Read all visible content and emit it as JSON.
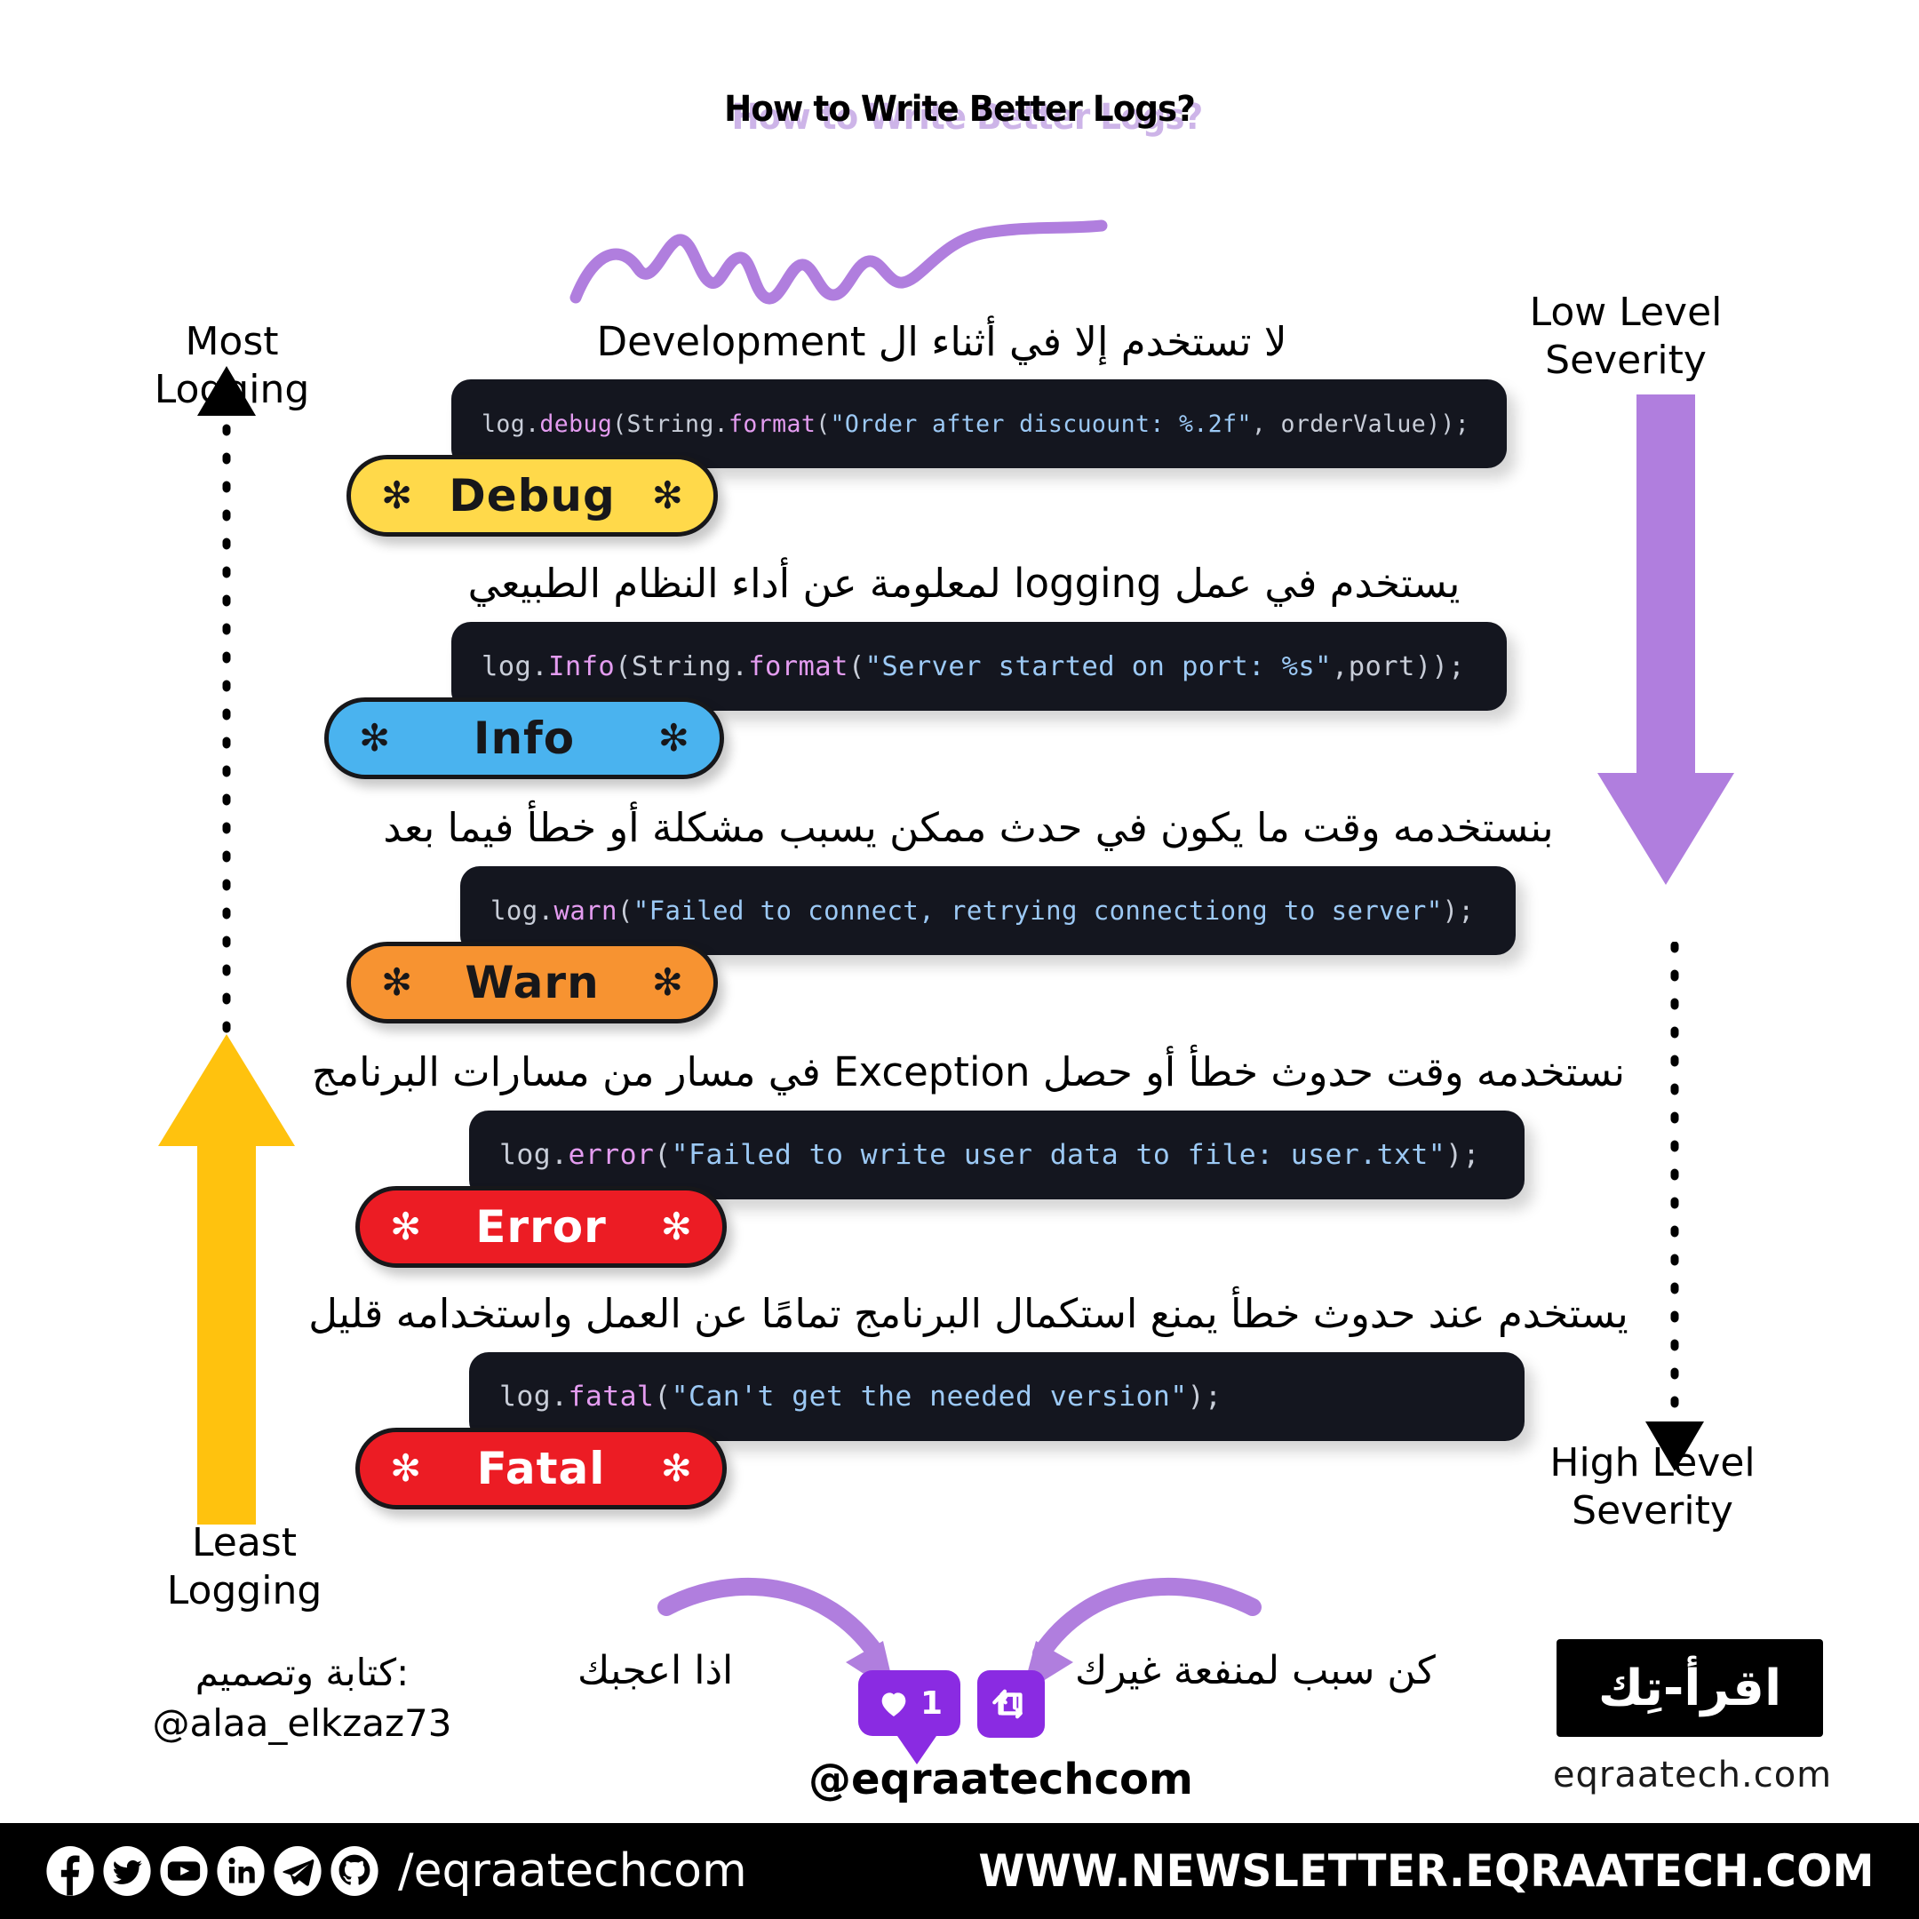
{
  "title": "How to Write Better Logs?",
  "axis": {
    "most_logging": "Most Logging",
    "least_logging": "Least Logging",
    "low_severity": "Low Level\nSeverity",
    "high_severity": "High Level\nSeverity"
  },
  "levels": [
    {
      "name": "Debug",
      "badge_label": "Debug",
      "badge_bg": "#ffd94a",
      "badge_text": "#17171a",
      "star": "✻",
      "description": "لا تستخدم إلا في أثناء ال Development",
      "code": [
        {
          "t": "log.",
          "c": "plain"
        },
        {
          "t": "debug",
          "c": "fn"
        },
        {
          "t": "(String.",
          "c": "plain"
        },
        {
          "t": "format",
          "c": "fn"
        },
        {
          "t": "(",
          "c": "plain"
        },
        {
          "t": "\"Order after discuount: %.2f\"",
          "c": "str"
        },
        {
          "t": ", orderValue));",
          "c": "plain"
        }
      ]
    },
    {
      "name": "Info",
      "badge_label": "Info",
      "badge_bg": "#4ab3ef",
      "badge_text": "#17171a",
      "star": "✻",
      "description": "يستخدم في عمل logging لمعلومة عن أداء النظام الطبيعي",
      "code": [
        {
          "t": "log.",
          "c": "plain"
        },
        {
          "t": "Info",
          "c": "fn"
        },
        {
          "t": "(String.",
          "c": "plain"
        },
        {
          "t": "format",
          "c": "fn"
        },
        {
          "t": "(",
          "c": "plain"
        },
        {
          "t": "\"Server started on port: %s\"",
          "c": "str"
        },
        {
          "t": ",port));",
          "c": "plain"
        }
      ]
    },
    {
      "name": "Warn",
      "badge_label": "Warn",
      "badge_bg": "#f79331",
      "badge_text": "#17171a",
      "star": "✻",
      "description": "بنستخدمه وقت ما يكون في حدث ممكن يسبب مشكلة أو خطأ فيما بعد",
      "code": [
        {
          "t": "log.",
          "c": "plain"
        },
        {
          "t": "warn",
          "c": "fn"
        },
        {
          "t": "(",
          "c": "plain"
        },
        {
          "t": "\"Failed to connect, retrying connectiong to server\"",
          "c": "str"
        },
        {
          "t": ");",
          "c": "plain"
        }
      ]
    },
    {
      "name": "Error",
      "badge_label": "Error",
      "badge_bg": "#ec1c24",
      "badge_text": "#ffffff",
      "star": "✻",
      "description": "نستخدمه وقت حدوث خطأ أو حصل Exception في مسار من مسارات البرنامج",
      "code": [
        {
          "t": "log.",
          "c": "plain"
        },
        {
          "t": "error",
          "c": "fn"
        },
        {
          "t": "(",
          "c": "plain"
        },
        {
          "t": "\"Failed to write user data to file: user.txt\"",
          "c": "str"
        },
        {
          "t": ");",
          "c": "plain"
        }
      ]
    },
    {
      "name": "Fatal",
      "badge_label": "Fatal",
      "badge_bg": "#ec1c24",
      "badge_text": "#ffffff",
      "star": "✻",
      "description": "يستخدم عند حدوث خطأ يمنع استكمال البرنامج  تمامًا عن العمل واستخدامه قليل",
      "code": [
        {
          "t": "log.",
          "c": "plain"
        },
        {
          "t": "fatal",
          "c": "fn"
        },
        {
          "t": "(",
          "c": "plain"
        },
        {
          "t": "\"Can't get the needed version\"",
          "c": "str"
        },
        {
          "t": ");",
          "c": "plain"
        }
      ]
    }
  ],
  "cta": {
    "like_text": "اذا اعجبك",
    "repost_text": "كن سبب لمنفعة غيرك",
    "like_count": "1",
    "handle": "@eqraatechcom"
  },
  "credit": "كتابة وتصميم:\n@alaa_elkzaz73",
  "logo": {
    "arabic": "اقرأ-تِك",
    "url": "eqraatech.com"
  },
  "footer": {
    "handle": "/eqraatechcom",
    "site": "WWW.NEWSLETTER.EQRAATECH.COM",
    "socials": [
      "facebook-icon",
      "twitter-icon",
      "youtube-icon",
      "linkedin-icon",
      "telegram-icon",
      "github-icon"
    ]
  },
  "colors": {
    "accent_purple": "#b07ede",
    "yellow_arrow": "#ffc20e",
    "code_bg": "#14161f"
  }
}
